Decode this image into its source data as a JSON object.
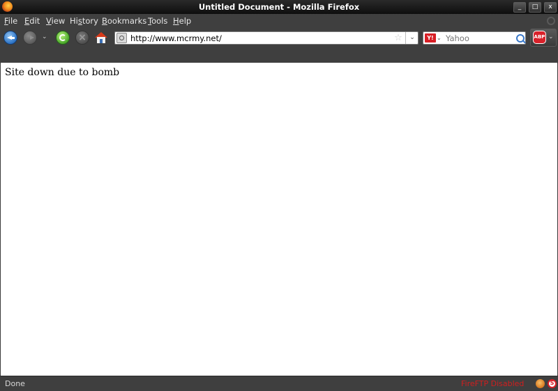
{
  "window": {
    "title": "Untitled Document - Mozilla Firefox",
    "minimize_glyph": "_",
    "maximize_glyph": "□",
    "close_glyph": "x"
  },
  "menubar": {
    "items": [
      {
        "accel": "F",
        "rest": "ile"
      },
      {
        "accel": "E",
        "rest": "dit"
      },
      {
        "accel": "V",
        "rest": "iew"
      },
      {
        "pre": "Hi",
        "accel": "s",
        "rest": "tory"
      },
      {
        "accel": "B",
        "rest": "ookmarks"
      },
      {
        "accel": "T",
        "rest": "ools"
      },
      {
        "accel": "H",
        "rest": "elp"
      }
    ]
  },
  "navbar": {
    "url": "http://www.mcrmy.net/",
    "dropdown_glyph": "⌄",
    "star_glyph": "☆"
  },
  "search": {
    "engine_glyph": "Y!",
    "placeholder": "Yahoo"
  },
  "addons": {
    "abp_label": "ABP"
  },
  "content": {
    "text": "Site down due to bomb"
  },
  "statusbar": {
    "status": "Done",
    "fireftp": "FireFTP Disabled"
  },
  "colors": {
    "chrome": "#3f3f3f",
    "titlebar": "#0e0e0e",
    "accent_red": "#d21e1e"
  }
}
